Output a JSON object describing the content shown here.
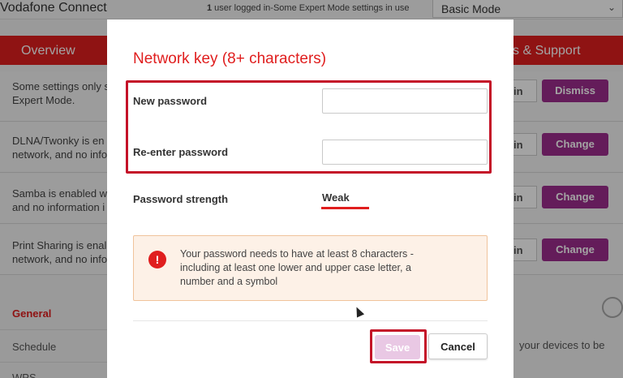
{
  "app": {
    "title": "Vodafone Connect",
    "status_count": "1",
    "status_rest": " user logged in-Some Expert Mode settings in use",
    "mode_selected": "Basic Mode"
  },
  "nav": {
    "overview": "Overview",
    "support": "s & Support"
  },
  "notices": [
    {
      "text": "Some settings only s Expert Mode.",
      "button": "Dismiss",
      "ghost": "in"
    },
    {
      "text": "DLNA/Twonky is en network, and no info",
      "button": "Change",
      "ghost": "in"
    },
    {
      "text": "Samba is enabled w and no information i",
      "button": "Change",
      "ghost": "in"
    },
    {
      "text": "Print Sharing is enal network, and no info",
      "button": "Change",
      "ghost": "in"
    }
  ],
  "sidebar": {
    "general": "General",
    "schedule": "Schedule",
    "wps": "WPS"
  },
  "background_text": {
    "devices": "your devices to be"
  },
  "modal": {
    "title": "Network key (8+ characters)",
    "new_password_label": "New password",
    "reenter_password_label": "Re-enter password",
    "new_password_value": "",
    "reenter_password_value": "",
    "strength_label": "Password strength",
    "strength_value": "Weak",
    "warning_text": "Your password needs to have at least 8 characters - including at least one lower and upper case letter, a number and a symbol",
    "warning_icon": "!",
    "save_label": "Save",
    "cancel_label": "Cancel"
  },
  "colors": {
    "brand_red": "#e01e1e",
    "purple": "#9d2c8e",
    "highlight": "#c41228",
    "save_disabled": "#e9c8e4"
  },
  "icons": {
    "warning": "exclamation-circle-icon",
    "dropdown": "chevron-down-icon",
    "help": "headset-icon"
  }
}
